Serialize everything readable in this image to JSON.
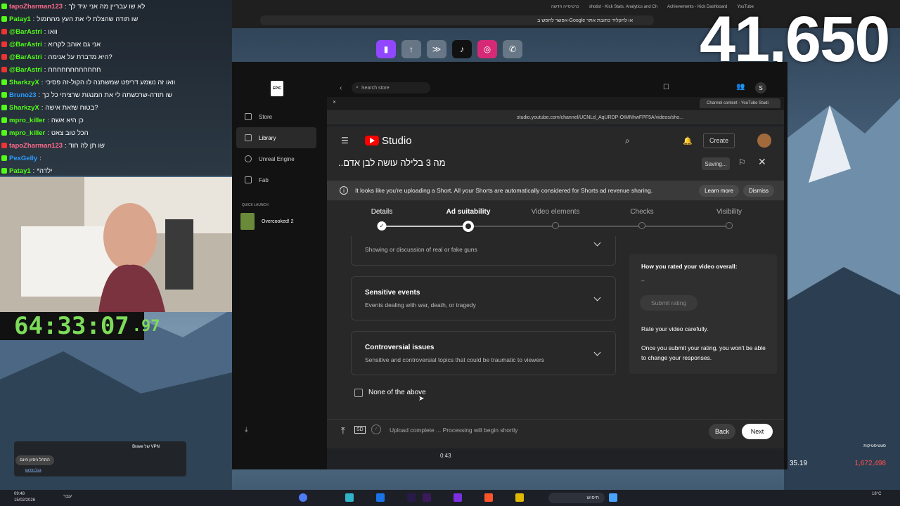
{
  "chat": [
    {
      "user": "tapoZharman123",
      "msg": "לא שו עבריין מה אני יגיד לך",
      "color": "#ff6b8a",
      "badge": "#53fc18"
    },
    {
      "user": "Patay1",
      "msg": "שו תודה שהצלת לי את העץ מהחמול",
      "color": "#53fc18",
      "badge": "#53fc18"
    },
    {
      "user": "@BarAstri",
      "msg": "וואו",
      "color": "#53fc18",
      "badge": "#e33"
    },
    {
      "user": "@BarAstri",
      "msg": "אני גם אוהב לקרוא",
      "color": "#53fc18",
      "badge": "#e33"
    },
    {
      "user": "@BarAstri",
      "msg": "היא מדברת על אנימה?",
      "color": "#53fc18",
      "badge": "#e33"
    },
    {
      "user": "@BarAstri",
      "msg": "חחחחחחחחחחחח",
      "color": "#53fc18",
      "badge": "#e33"
    },
    {
      "user": "SharkzyX",
      "msg": "וואו זה נשמע דריפט שמשתנה לו הקול-זה פסיכי",
      "color": "#53fc18",
      "badge": "#53fc18"
    },
    {
      "user": "Bruno23",
      "msg": "שו תודה-שרכשתה לי את המנגות שרציתי כל כך",
      "color": "#2b9bff",
      "badge": "#53fc18"
    },
    {
      "user": "SharkzyX",
      "msg": "בטוח שזאת אישה?",
      "color": "#53fc18",
      "badge": "#53fc18"
    },
    {
      "user": "mpro_killer",
      "msg": "כן היא אשה",
      "color": "#53fc18",
      "badge": "#53fc18"
    },
    {
      "user": "mpro_killer",
      "msg": "הכל טוב צאט",
      "color": "#53fc18",
      "badge": "#53fc18"
    },
    {
      "user": "tapoZharman123",
      "msg": "שו תן לה חוד",
      "color": "#ff6b8a",
      "badge": "#e33"
    },
    {
      "user": "PexGelly",
      "msg": "",
      "color": "#2b9bff",
      "badge": "#53fc18"
    },
    {
      "user": "Patay1",
      "msg": "*ילדה",
      "color": "#53fc18",
      "badge": "#53fc18"
    }
  ],
  "timer": {
    "main": "64:33:07",
    "frac": ".97"
  },
  "viewer_count": "41,650",
  "top_tabs": [
    "כרטיסייה חדשה",
    "shotist - Kick Stats, Analytics and Ch",
    "Achievements - Kick Dashboard",
    "YouTube"
  ],
  "top_address": "אפשר לחפש ב-Google או להקליד כתובת אתר",
  "epic": {
    "search_placeholder": "Search store",
    "nav": [
      {
        "label": "Store",
        "icon": "tag-icon"
      },
      {
        "label": "Library",
        "icon": "grid-icon",
        "active": true
      },
      {
        "label": "Unreal Engine",
        "icon": "unreal-icon"
      },
      {
        "label": "Fab",
        "icon": "fab-icon"
      }
    ],
    "quick_launch_title": "QUICK LAUNCH",
    "quick_launch_game": "Overcooked! 2"
  },
  "chrome": {
    "tab_title": "Channel content - YouTube Studi",
    "url": "studio.youtube.com/channel/UCNLd_AqURDP-OIMNhwFPF5A/videos/sho..."
  },
  "studio": {
    "logo_text": "Studio",
    "create_label": "Create"
  },
  "dialog": {
    "title": "..מה 3 בלילה עושה לבן אדם",
    "saving": "Saving...",
    "info_text": "It looks like you're uploading a Short. All your Shorts are automatically considered for Shorts ad revenue sharing.",
    "learn_more": "Learn more",
    "dismiss": "Dismiss",
    "steps": [
      {
        "label": "Details",
        "state": "done"
      },
      {
        "label": "Ad suitability",
        "state": "current"
      },
      {
        "label": "Video elements",
        "state": "todo"
      },
      {
        "label": "Checks",
        "state": "todo"
      },
      {
        "label": "Visibility",
        "state": "todo"
      }
    ],
    "cards": [
      {
        "title": "",
        "sub": "Showing or discussion of real or fake guns"
      },
      {
        "title": "Sensitive events",
        "sub": "Events dealing with war, death, or tragedy"
      },
      {
        "title": "Controversial issues",
        "sub": "Sensitive and controversial topics that could be traumatic to viewers"
      }
    ],
    "none_above": "None of the above",
    "rating": {
      "heading": "How you rated your video overall:",
      "value": "–",
      "submit": "Submit rating",
      "careful": "Rate your video carefully.",
      "note": "Once you submit your rating, you won't be able to change your responses."
    },
    "footer_status": "Upload complete ... Processing will begin shortly",
    "sd_badge": "SD",
    "back": "Back",
    "next": "Next"
  },
  "bottom": {
    "video_time": "0:43",
    "vpn_title": "Brave של VPN",
    "vpn_button": "התחל ניסיון חינם",
    "vpn_link": "בכל החינם",
    "stat_label": "סטטיסטיקות",
    "stat_left": "35.19",
    "stat_right": "1,672,498",
    "taskbar_time": "09:48",
    "taskbar_date": "15/02/2026",
    "taskbar_temp": "18°C",
    "taskbar_search": "חיפוש",
    "taskbar_lang": "עבר"
  }
}
